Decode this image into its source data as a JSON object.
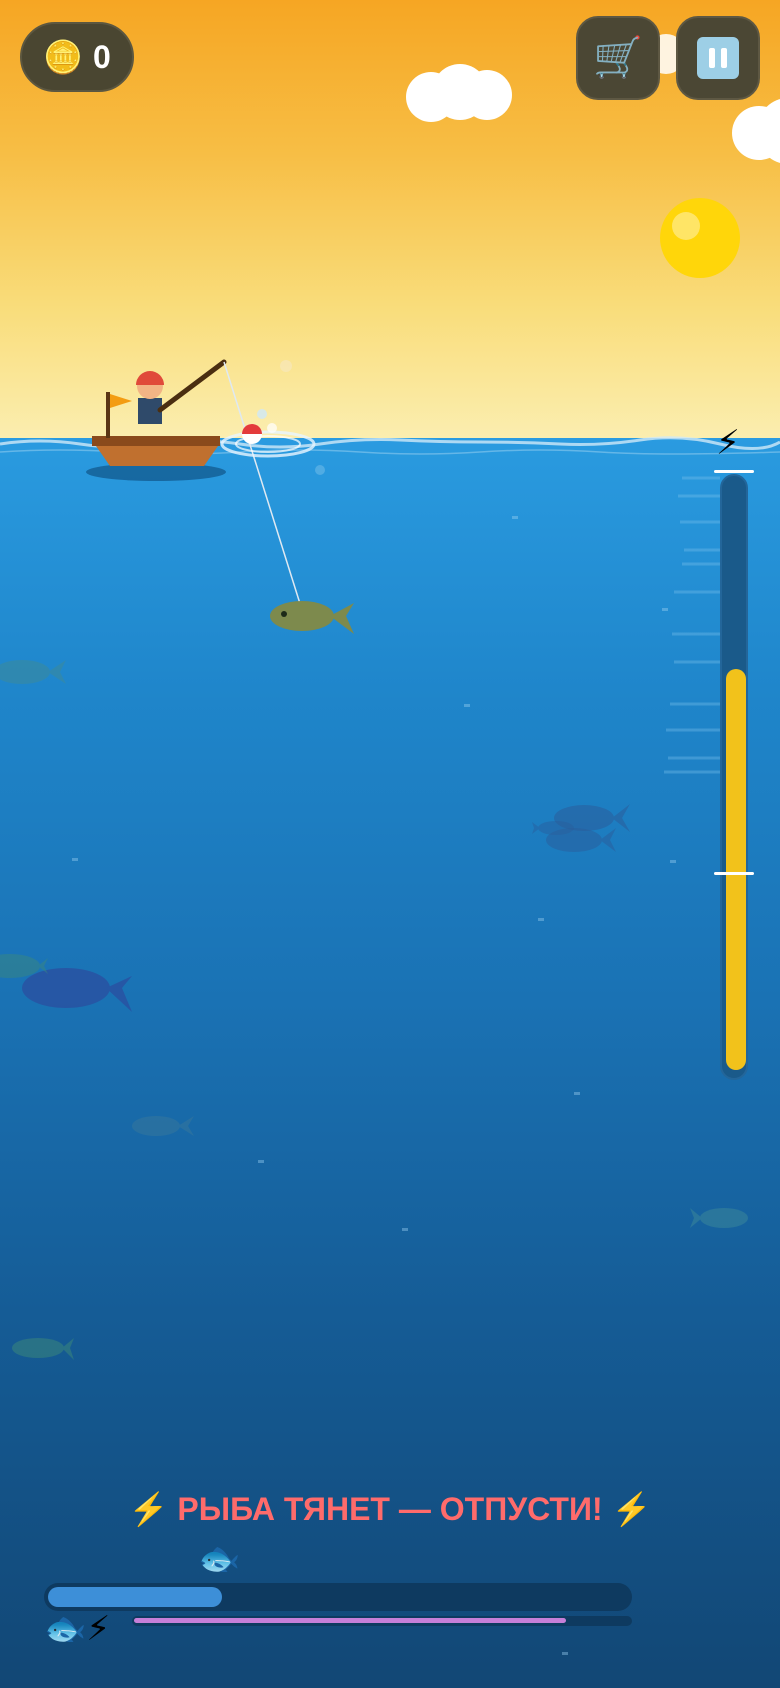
{
  "hud": {
    "coins": "0",
    "coin_icon": "coin-icon",
    "shop_icon": "cart-icon",
    "pause_icon": "pause-icon"
  },
  "tension_meter": {
    "icon": "⚡",
    "level": 0.68
  },
  "status": {
    "message": "⚡ РЫБА ТЯНЕТ — ОТПУСТИ! ⚡"
  },
  "catch_progress": {
    "icon": "🐟",
    "level": 0.3
  },
  "stamina": {
    "icons": "🐟⚡",
    "level": 0.87
  },
  "colors": {
    "meter_fill": "#f2c21b",
    "warning_text": "#ff6b6b",
    "progress_fill": "#3d8fd8",
    "stamina_fill": "#c67fd8"
  }
}
